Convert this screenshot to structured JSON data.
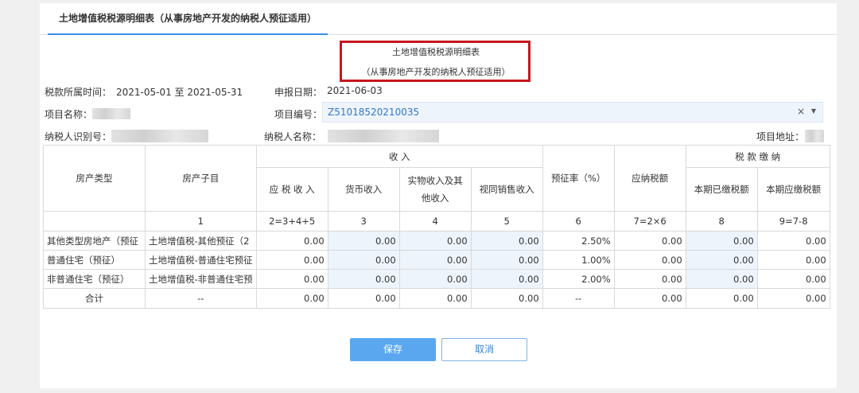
{
  "tab": {
    "label": "土地增值税税源明细表（从事房地产开发的纳税人预征适用）"
  },
  "form": {
    "title": "土地增值税税源明细表",
    "subtitle": "（从事房地产开发的纳税人预征适用）"
  },
  "info": {
    "period_label": "税款所属时间：",
    "period_value": "2021-05-01 至 2021-05-31",
    "report_date_label": "申报日期：",
    "report_date_value": "2021-06-03",
    "project_name_label": "项目名称：",
    "project_code_label": "项目编号：",
    "project_code_value": "Z51018520210035",
    "clear_symbol": "×",
    "dropdown_symbol": "▼",
    "taxpayer_id_label": "纳税人识别号：",
    "taxpayer_name_label": "纳税人名称：",
    "project_address_label": "项目地址："
  },
  "table": {
    "headers": {
      "property_type": "房产类型",
      "property_sub": "房产子目",
      "income": "收 入",
      "taxable_income": "应 税 收 入",
      "cash_income": "货币收入",
      "inkind_income": "实物收入及其他收入",
      "deemed_sales": "视同销售收入",
      "prepay_rate": "预征率（%）",
      "tax_payable": "应纳税额",
      "tax_payment": "税 款 缴 纳",
      "paid_this_period": "本期已缴税额",
      "due_this_period": "本期应缴税额"
    },
    "formula_row": [
      "",
      "1",
      "2=3+4+5",
      "3",
      "4",
      "5",
      "6",
      "7=2×6",
      "8",
      "9=7-8"
    ],
    "rows": [
      {
        "type": "其他类型房地产（预征",
        "sub": "土地增值税-其他预征（2",
        "taxable": "0.00",
        "cash": "0.00",
        "inkind": "0.00",
        "deemed": "0.00",
        "rate": "2.50%",
        "payable": "0.00",
        "paid": "0.00",
        "due": "0.00"
      },
      {
        "type": "普通住宅（预征）",
        "sub": "土地增值税-普通住宅预征",
        "taxable": "0.00",
        "cash": "0.00",
        "inkind": "0.00",
        "deemed": "0.00",
        "rate": "1.00%",
        "payable": "0.00",
        "paid": "0.00",
        "due": "0.00"
      },
      {
        "type": "非普通住宅（预征）",
        "sub": "土地增值税-非普通住宅预",
        "taxable": "0.00",
        "cash": "0.00",
        "inkind": "0.00",
        "deemed": "0.00",
        "rate": "2.00%",
        "payable": "0.00",
        "paid": "0.00",
        "due": "0.00"
      }
    ],
    "total": {
      "label": "合计",
      "sub": "--",
      "taxable": "0.00",
      "cash": "0.00",
      "inkind": "0.00",
      "deemed": "0.00",
      "rate": "--",
      "payable": "0.00",
      "paid": "0.00",
      "due": "0.00"
    }
  },
  "buttons": {
    "save": "保存",
    "cancel": "取消"
  },
  "colors": {
    "accent": "#3a8ee6",
    "highlight_box": "#c8161d",
    "editable_bg": "#eef4fc",
    "save_bg": "#5aa7ef"
  }
}
